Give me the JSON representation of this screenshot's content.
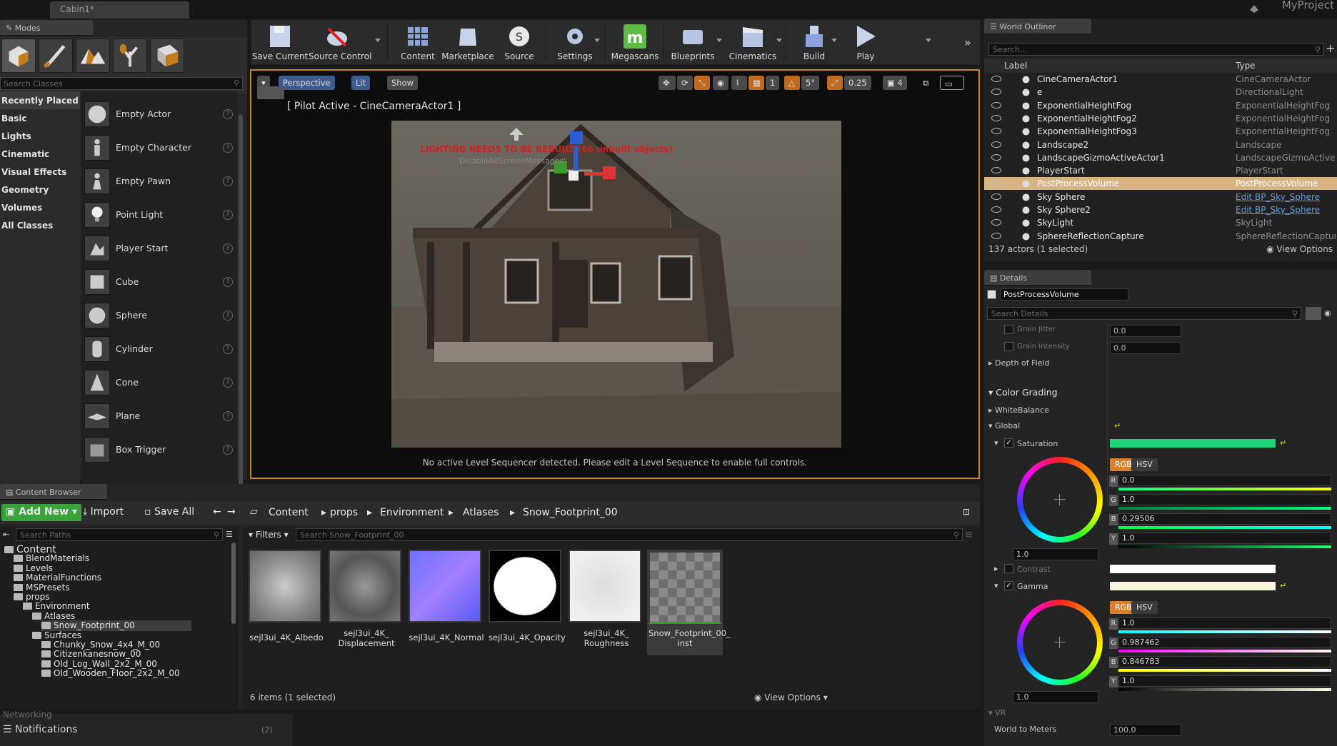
{
  "window": {
    "doc_tab": "Cabin1*",
    "project": "MyProject"
  },
  "modes": {
    "tab": "Modes",
    "search_placeholder": "Search Classes",
    "categories": [
      "Recently Placed",
      "Basic",
      "Lights",
      "Cinematic",
      "Visual Effects",
      "Geometry",
      "Volumes",
      "All Classes"
    ],
    "items": [
      "Empty Actor",
      "Empty Character",
      "Empty Pawn",
      "Point Light",
      "Player Start",
      "Cube",
      "Sphere",
      "Cylinder",
      "Cone",
      "Plane",
      "Box Trigger"
    ]
  },
  "toolbar": {
    "buttons": [
      "Save Current",
      "Source Control",
      "Content",
      "Marketplace",
      "Source",
      "Settings",
      "Megascans",
      "Blueprints",
      "Cinematics",
      "Build",
      "Play"
    ]
  },
  "viewport": {
    "perspective": "Perspective",
    "lit": "Lit",
    "show": "Show",
    "grid_snap": "1",
    "rot_snap": "5°",
    "scale_snap": "0.25",
    "cam_speed": "4",
    "pilot": "[ Pilot Active - CineCameraActor1 ]",
    "lighting_warning": "LIGHTING NEEDS TO BE REBUILT (66 unbuilt objects)",
    "lighting_sub": "'DisableAllScreenMessages'",
    "sequencer_msg": "No active Level Sequencer detected. Please edit a Level Sequence to enable full controls."
  },
  "outliner": {
    "tab": "World Outliner",
    "search_placeholder": "Search...",
    "col_label": "Label",
    "col_type": "Type",
    "rows": [
      {
        "label": "CineCameraActor1",
        "type": "CineCameraActor",
        "link": false
      },
      {
        "label": "e",
        "type": "DirectionalLight",
        "link": false
      },
      {
        "label": "ExponentialHeightFog",
        "type": "ExponentialHeightFog",
        "link": false
      },
      {
        "label": "ExponentialHeightFog2",
        "type": "ExponentialHeightFog",
        "link": false
      },
      {
        "label": "ExponentialHeightFog3",
        "type": "ExponentialHeightFog",
        "link": false
      },
      {
        "label": "Landscape2",
        "type": "Landscape",
        "link": false
      },
      {
        "label": "LandscapeGizmoActiveActor1",
        "type": "LandscapeGizmoActiveActor",
        "link": false
      },
      {
        "label": "PlayerStart",
        "type": "PlayerStart",
        "link": false
      },
      {
        "label": "PostProcessVolume",
        "type": "PostProcessVolume",
        "link": false
      },
      {
        "label": "Sky Sphere",
        "type": "Edit BP_Sky_Sphere",
        "link": true
      },
      {
        "label": "Sky Sphere2",
        "type": "Edit BP_Sky_Sphere",
        "link": true
      },
      {
        "label": "SkyLight",
        "type": "SkyLight",
        "link": false
      },
      {
        "label": "SphereReflectionCapture",
        "type": "SphereReflectionCapture",
        "link": false
      }
    ],
    "selected_index": 8,
    "status": "137 actors (1 selected)",
    "view_options": "View Options"
  },
  "details": {
    "tab": "Details",
    "object_name": "PostProcessVolume",
    "search_placeholder": "Search Details",
    "grain_jitter_label": "Grain Jitter",
    "grain_jitter": "0.0",
    "grain_intensity_label": "Grain Intensity",
    "grain_intensity": "0.0",
    "dof": "Depth of Field",
    "color_grading": "Color Grading",
    "white_balance": "WhiteBalance",
    "global": "Global",
    "saturation": "Saturation",
    "sat": {
      "r": "0.0",
      "g": "1.0",
      "b": "0.29506",
      "y": "1.0",
      "wheel": "1.0"
    },
    "contrast": "Contrast",
    "gamma": "Gamma",
    "gam": {
      "r": "1.0",
      "g": "0.987462",
      "b": "0.846783",
      "y": "1.0",
      "wheel": "1.0"
    },
    "rgb": "RGB",
    "hsv": "HSV",
    "vr": "VR",
    "world_to_meters_label": "World to Meters",
    "world_to_meters": "100.0"
  },
  "content_browser": {
    "tab": "Content Browser",
    "add_new": "Add New",
    "import": "Import",
    "save_all": "Save All",
    "breadcrumbs": [
      "Content",
      "props",
      "Environment",
      "Atlases",
      "Snow_Footprint_00"
    ],
    "search_paths": "Search Paths",
    "filters": "Filters",
    "search_assets": "Search Snow_Footprint_00",
    "tree": [
      {
        "label": "Content",
        "indent": 0
      },
      {
        "label": "BlendMaterials",
        "indent": 1
      },
      {
        "label": "Levels",
        "indent": 1
      },
      {
        "label": "MaterialFunctions",
        "indent": 1
      },
      {
        "label": "MSPresets",
        "indent": 1
      },
      {
        "label": "props",
        "indent": 1
      },
      {
        "label": "Environment",
        "indent": 2
      },
      {
        "label": "Atlases",
        "indent": 3
      },
      {
        "label": "Snow_Footprint_00",
        "indent": 4
      },
      {
        "label": "Surfaces",
        "indent": 3
      },
      {
        "label": "Chunky_Snow_4x4_M_00",
        "indent": 4
      },
      {
        "label": "Citizenkanesnow_00",
        "indent": 4
      },
      {
        "label": "Old_Log_Wall_2x2_M_00",
        "indent": 4
      },
      {
        "label": "Old_Wooden_Floor_2x2_M_00",
        "indent": 4
      }
    ],
    "assets": [
      "sejl3ui_4K_Albedo",
      "sejl3ui_4K_\nDisplacement",
      "sejl3ui_4K_Normal",
      "sejl3ui_4K_Opacity",
      "sejl3ui_4K_\nRoughness",
      "Snow_Footprint_00_\ninst"
    ],
    "status": "6 items (1 selected)",
    "view_options": "View Options"
  },
  "bottom": {
    "networking": "Networking",
    "notifications": "Notifications",
    "notif_count": "(2)"
  }
}
